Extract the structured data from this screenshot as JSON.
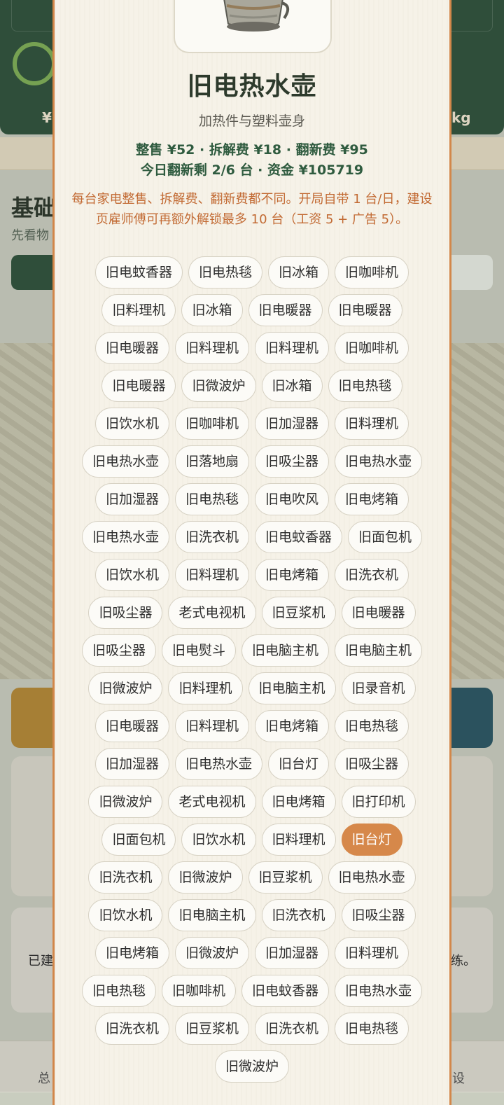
{
  "background": {
    "header_left": "¥",
    "header_right": "kg",
    "section_title": "基础",
    "section_subtitle": "先看物",
    "card_left_text": "已建",
    "card_right_text": "练。",
    "nav_left": "总",
    "nav_right": "设"
  },
  "modal": {
    "title": "旧电热水壶",
    "description": "加热件与塑料壶身",
    "stats_line1": "整售 ¥52 · 拆解费 ¥18 · 翻新费 ¥95",
    "stats_line2": "今日翻新剩 2/6 台 · 资金 ¥105719",
    "note": "每台家电整售、拆解费、翻新费都不同。开局自带 1 台/日，建设页雇师傅可再额外解锁最多 10 台（工资 5 + 广告 5）。",
    "selected_index": 63,
    "items": [
      "旧电蚊香器",
      "旧电热毯",
      "旧冰箱",
      "旧咖啡机",
      "旧料理机",
      "旧冰箱",
      "旧电暖器",
      "旧电暖器",
      "旧电暖器",
      "旧料理机",
      "旧料理机",
      "旧咖啡机",
      "旧电暖器",
      "旧微波炉",
      "旧冰箱",
      "旧电热毯",
      "旧饮水机",
      "旧咖啡机",
      "旧加湿器",
      "旧料理机",
      "旧电热水壶",
      "旧落地扇",
      "旧吸尘器",
      "旧电热水壶",
      "旧加湿器",
      "旧电热毯",
      "旧电吹风",
      "旧电烤箱",
      "旧电热水壶",
      "旧洗衣机",
      "旧电蚊香器",
      "旧面包机",
      "旧饮水机",
      "旧料理机",
      "旧电烤箱",
      "旧洗衣机",
      "旧吸尘器",
      "老式电视机",
      "旧豆浆机",
      "旧电暖器",
      "旧吸尘器",
      "旧电熨斗",
      "旧电脑主机",
      "旧电脑主机",
      "旧微波炉",
      "旧料理机",
      "旧电脑主机",
      "旧录音机",
      "旧电暖器",
      "旧料理机",
      "旧电烤箱",
      "旧电热毯",
      "旧加湿器",
      "旧电热水壶",
      "旧台灯",
      "旧吸尘器",
      "旧微波炉",
      "老式电视机",
      "旧电烤箱",
      "旧打印机",
      "旧面包机",
      "旧饮水机",
      "旧料理机",
      "旧台灯",
      "旧洗衣机",
      "旧微波炉",
      "旧豆浆机",
      "旧电热水壶",
      "旧饮水机",
      "旧电脑主机",
      "旧洗衣机",
      "旧吸尘器",
      "旧电烤箱",
      "旧微波炉",
      "旧加湿器",
      "旧料理机",
      "旧电热毯",
      "旧咖啡机",
      "旧电蚊香器",
      "旧电热水壶",
      "旧洗衣机",
      "旧豆浆机",
      "旧洗衣机",
      "旧电热毯",
      "旧微波炉"
    ]
  },
  "colors": {
    "accent": "#d6884a",
    "header_green": "#33553f",
    "stats_green": "#2f5b3f",
    "note_orange": "#c26a33"
  }
}
